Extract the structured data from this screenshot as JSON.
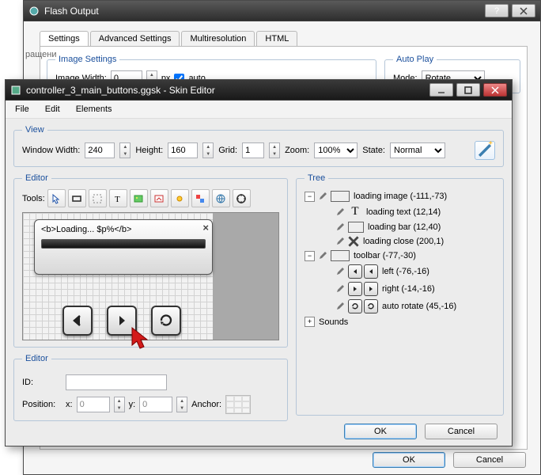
{
  "back_window": {
    "title": "Flash Output",
    "left_sidebar_fragment": "ращени",
    "tabs": [
      "Settings",
      "Advanced Settings",
      "Multiresolution",
      "HTML"
    ],
    "active_tab": 0,
    "image_settings": {
      "legend": "Image Settings",
      "width_label": "Image Width:",
      "width_value": "0",
      "unit": "px",
      "auto_label": "auto",
      "auto_checked": true
    },
    "auto_play": {
      "legend": "Auto Play",
      "mode_label": "Mode:",
      "mode_value": "Rotate"
    },
    "buttons": {
      "ok": "OK",
      "cancel": "Cancel"
    }
  },
  "front_window": {
    "title": "controller_3_main_buttons.ggsk - Skin Editor",
    "menu": [
      "File",
      "Edit",
      "Elements"
    ],
    "view": {
      "legend": "View",
      "width_label": "Window Width:",
      "width_value": "240",
      "height_label": "Height:",
      "height_value": "160",
      "grid_label": "Grid:",
      "grid_value": "1",
      "zoom_label": "Zoom:",
      "zoom_value": "100%",
      "state_label": "State:",
      "state_value": "Normal"
    },
    "editor": {
      "legend": "Editor",
      "tools_label": "Tools:",
      "loading_text": "<b>Loading... $p%</b>"
    },
    "props": {
      "legend": "Editor",
      "id_label": "ID:",
      "id_value": "",
      "pos_label": "Position:",
      "x_label": "x:",
      "x_value": "0",
      "y_label": "y:",
      "y_value": "0",
      "anchor_label": "Anchor:"
    },
    "tree": {
      "legend": "Tree",
      "items": [
        {
          "label": "loading image (-111,-73)"
        },
        {
          "label": "loading text (12,14)"
        },
        {
          "label": "loading bar (12,40)"
        },
        {
          "label": "loading close (200,1)"
        },
        {
          "label": "toolbar (-77,-30)"
        },
        {
          "label": "left (-76,-16)"
        },
        {
          "label": "right (-14,-16)"
        },
        {
          "label": "auto rotate (45,-16)"
        },
        {
          "label": "Sounds"
        }
      ]
    },
    "buttons": {
      "ok": "OK",
      "cancel": "Cancel"
    }
  }
}
